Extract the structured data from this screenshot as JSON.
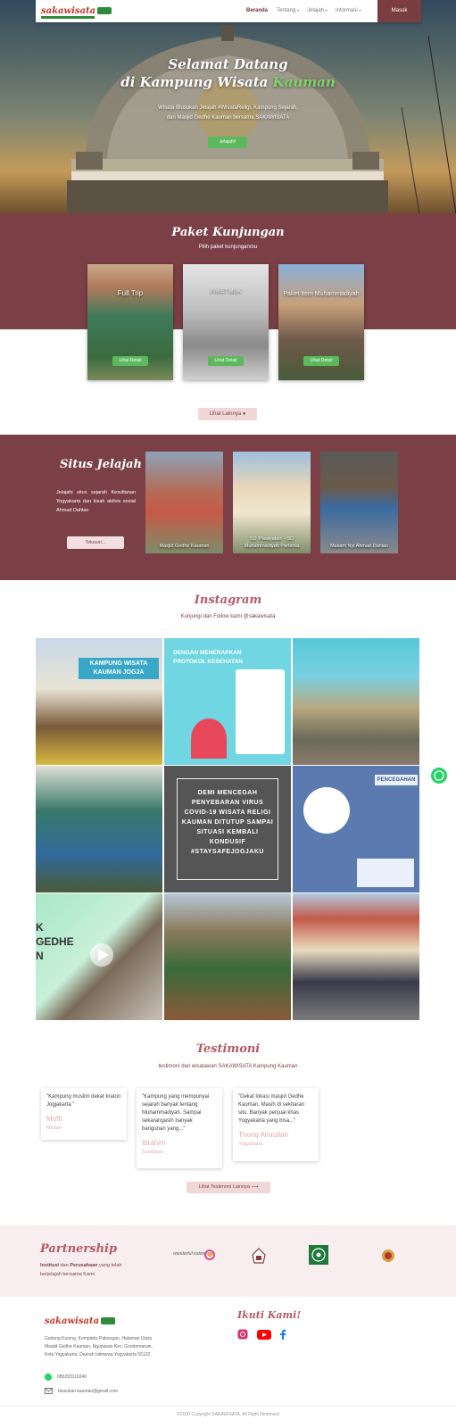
{
  "nav": {
    "brand": "sakawisata",
    "links": [
      {
        "label": "Beranda",
        "active": true
      },
      {
        "label": "Tentang",
        "caret": "▾"
      },
      {
        "label": "Jelajah",
        "caret": "▾"
      },
      {
        "label": "Informasi",
        "caret": "▾"
      }
    ],
    "login_label": "Masuk"
  },
  "hero": {
    "title_line1": "Selamat Datang",
    "title_line2_prefix": "di Kampung Wisata ",
    "title_line2_highlight": "Kauman",
    "subtitle_line1": "Wisata Blusukan Jelajah #WisataReligi, Kampung Sejarah,",
    "subtitle_line2": "dan Masjid Gedhe Kauman bersama SAKAWISATA",
    "button": "Jelajahi!"
  },
  "paket": {
    "title": "Paket Kunjungan",
    "subtitle": "Pilih paket kunjunganmu",
    "cards": [
      {
        "label": "Full Trip",
        "button": "Lihat Detail"
      },
      {
        "label": "PAKET MGK",
        "button": "Lihat Detail"
      },
      {
        "label": "Paket Item Muhammadiyah",
        "button": "Lihat Detail"
      }
    ],
    "more_button": "Lihat Lainnya ●"
  },
  "situs": {
    "title": "Situs Jelajah",
    "description": "Jelajahi situs sejarah Kesultanan Yogyakarta dan kisah aktivis sosial Ahmad Dahlan",
    "button": "Telusuri...",
    "cards": [
      {
        "label": "Masjid Gedhe Kauman"
      },
      {
        "label": "SD 'Pawiyatan' - SD Muhammadiyah Pertama"
      },
      {
        "label": "Makam Nyi Ahmad Dahlan"
      }
    ]
  },
  "instagram": {
    "title": "Instagram",
    "subtitle": "Kunjungi dan Follow kami @sakawisata",
    "posts": [
      {
        "text": "KAMPUNG WISATA KAUMAN JOGJA"
      },
      {
        "text": "DENGAN MENERAPKAN PROTOKOL KESEHATAN"
      },
      {
        "text": ""
      },
      {
        "text": ""
      },
      {
        "text": "DEMI MENCEGAH PENYEBARAN VIRUS COVID-19 WISATA RELIGI KAUMAN DITUTUP SAMPAI SITUASI KEMBALI KONDUSIF #STAYSAFEJOGJAKU"
      },
      {
        "text": "PENCEGAHAN"
      },
      {
        "text": "K GEDHE N"
      },
      {
        "text": ""
      },
      {
        "text": ""
      }
    ]
  },
  "testimoni": {
    "title": "Testimoni",
    "subtitle": "testimoni dari wisatawan SAKAWISATA Kampung Kauman",
    "items": [
      {
        "quote": "\"Kampung muslim dekat kraton Jogjakarta \"",
        "name": "Mufti",
        "city": "Medan"
      },
      {
        "quote": "\"Kampung yang mempunyai sejarah banyak tentang Muhammadiyah. Sampai sekarangasih banyak bangunan yang...\"",
        "name": "Ibrahim",
        "city": "Surabaya"
      },
      {
        "quote": "\"Dekat lokasi masjid Gedhe Kauman. Masih di sekitaran situ. Banyak penjual khas Yogyakarta yang bisa...\"",
        "name": "Thoriq Amrullah",
        "city": "Yogyakarta"
      }
    ],
    "more_button": "Lihat Testimoni Lainnya ⟶"
  },
  "partnership": {
    "title": "Partnership",
    "desc_b1": "Institusi",
    "desc_mid": " dan ",
    "desc_b2": "Perusahaan",
    "desc_end": " yang telah berjelajah bersama Kami",
    "logos": [
      "wonderful indonesia",
      "logo-2",
      "muhammadiyah",
      "logo-4"
    ],
    "wonderful_text": "wonderful indonesia"
  },
  "footer": {
    "brand": "sakawisata",
    "address": "Gedung Kuning, Kompleks Pabongan, Halaman Utara Masjid Gedhe Kauman, Ngupasan Kec. Gondomanan, Kota Yogyakarta, Daerah Istimewa Yogyakarta 55122",
    "phone": "085293116340",
    "email": "blusukan.kauman@gmail.com",
    "follow_title": "Ikuti Kami!",
    "copyright": "©2020 Copyright SAKAWISATA. All Right Reserved"
  },
  "colors": {
    "maroon": "#7b3f46",
    "accent_green": "#5cb85c",
    "pink": "#b45a66"
  }
}
